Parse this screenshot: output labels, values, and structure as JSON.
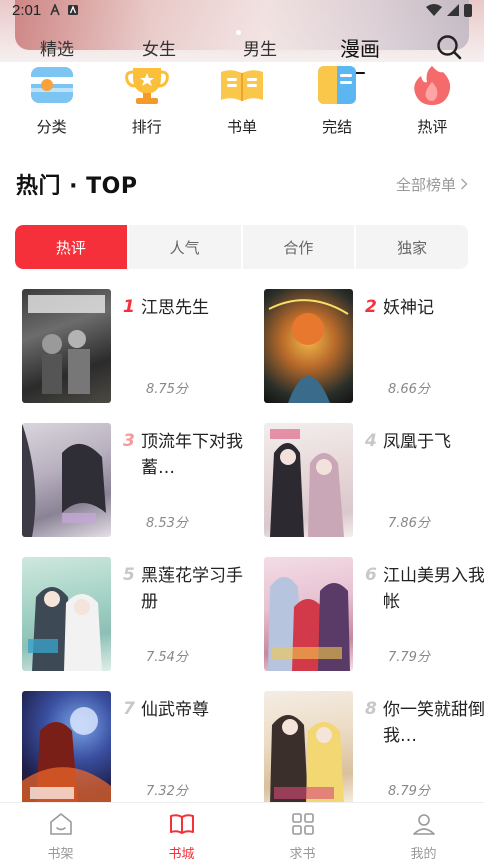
{
  "status_bar": {
    "time": "2:01"
  },
  "top_tabs": [
    {
      "label": "精选",
      "active": false
    },
    {
      "label": "女生",
      "active": false
    },
    {
      "label": "男生",
      "active": false
    },
    {
      "label": "漫画",
      "active": true
    }
  ],
  "categories": [
    {
      "label": "分类",
      "icon": "category-icon"
    },
    {
      "label": "排行",
      "icon": "trophy-icon"
    },
    {
      "label": "书单",
      "icon": "book-list-icon"
    },
    {
      "label": "完结",
      "icon": "finished-icon"
    },
    {
      "label": "热评",
      "icon": "hot-comment-icon"
    }
  ],
  "section": {
    "title": "热门 · TOP",
    "more": "全部榜单"
  },
  "rank_tabs": [
    {
      "label": "热评",
      "active": true
    },
    {
      "label": "人气",
      "active": false
    },
    {
      "label": "合作",
      "active": false
    },
    {
      "label": "独家",
      "active": false
    }
  ],
  "books": [
    {
      "rank": "1",
      "title": "江思先生",
      "score": "8.75分"
    },
    {
      "rank": "2",
      "title": "妖神记",
      "score": "8.66分"
    },
    {
      "rank": "3",
      "title": "顶流年下对我蓄…",
      "score": "8.53分"
    },
    {
      "rank": "4",
      "title": "凤凰于飞",
      "score": "7.86分"
    },
    {
      "rank": "5",
      "title": "黑莲花学习手册",
      "score": "7.54分"
    },
    {
      "rank": "6",
      "title": "江山美男入我帐",
      "score": "7.79分"
    },
    {
      "rank": "7",
      "title": "仙武帝尊",
      "score": "7.32分"
    },
    {
      "rank": "8",
      "title": "你一笑就甜倒我…",
      "score": "8.79分"
    }
  ],
  "bottom_nav": [
    {
      "label": "书架",
      "active": false
    },
    {
      "label": "书城",
      "active": true
    },
    {
      "label": "求书",
      "active": false
    },
    {
      "label": "我的",
      "active": false
    }
  ],
  "colors": {
    "accent": "#f5303a",
    "rank_top": "#f5303a",
    "rank_mid": "#f49a9a",
    "rank_low": "#c8c8c8"
  }
}
